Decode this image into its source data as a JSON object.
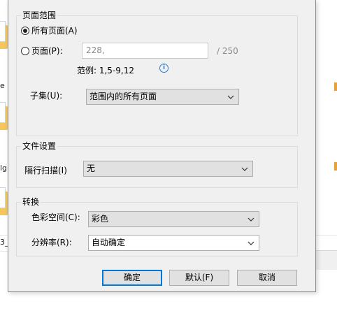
{
  "background": {
    "labels": [
      "e",
      "lg",
      "3_"
    ]
  },
  "dialog": {
    "page_range": {
      "title": "页面范围",
      "all_pages": {
        "label": "所有页面(A)",
        "checked": true
      },
      "pages": {
        "label": "页面(P):",
        "checked": false,
        "value": "228,",
        "total": "/ 250"
      },
      "example_label": "范例: 1,5-9,12",
      "info_icon": "info-icon",
      "subset": {
        "label": "子集(U):",
        "value": "范围内的所有页面"
      }
    },
    "file_settings": {
      "title": "文件设置",
      "interlace": {
        "label": "隔行扫描(I)",
        "value": "无"
      }
    },
    "conversion": {
      "title": "转换",
      "color_space": {
        "label": "色彩空间(C):",
        "value": "彩色"
      },
      "resolution": {
        "label": "分辨率(R):",
        "value": "自动确定"
      }
    },
    "buttons": {
      "ok": "确定",
      "defaults": "默认(F)",
      "cancel": "取消"
    }
  },
  "colors": {
    "dialog_bg": "#f0f0f0",
    "accent": "#0078d7",
    "info": "#2b7cd3",
    "folder": "#f4c65b"
  }
}
